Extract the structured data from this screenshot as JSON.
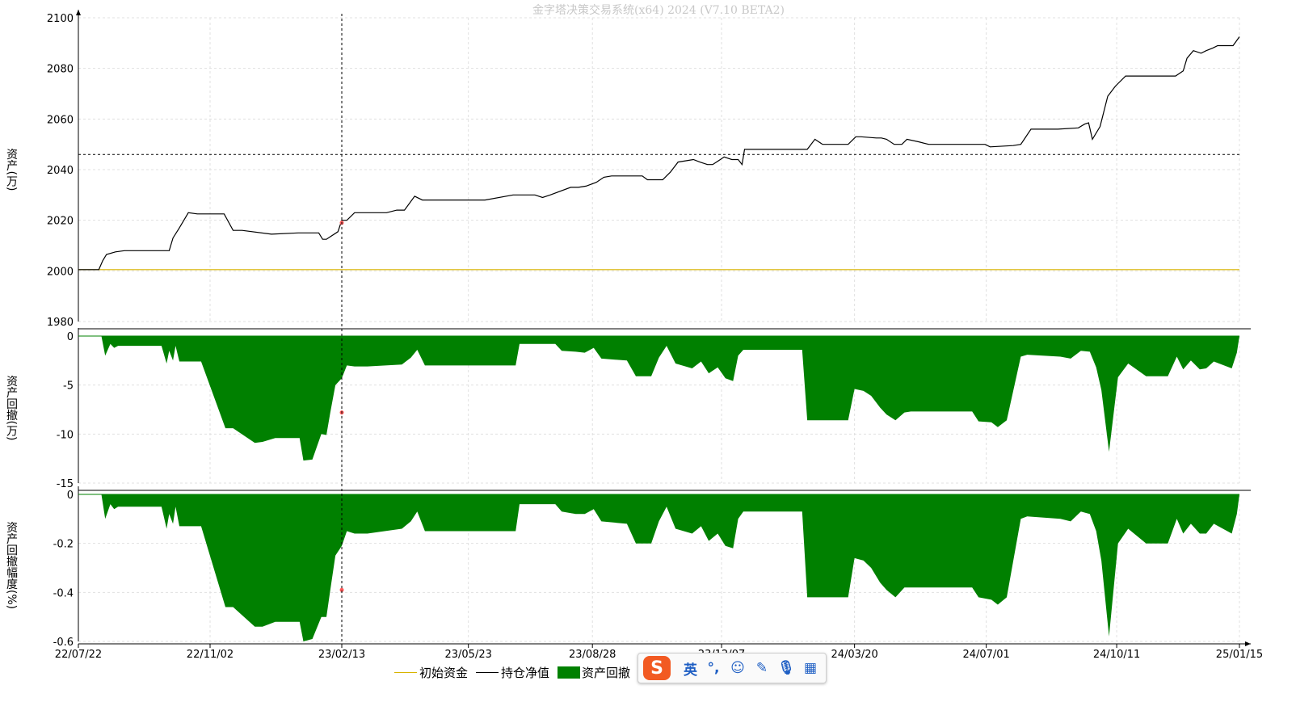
{
  "window": {
    "title": "金字塔决策交易系统(x64) 2024 (V7.10 BETA2)"
  },
  "legend": {
    "initial_capital": "初始资金",
    "position_value": "持仓净值",
    "asset_drawdown": "资产回撤"
  },
  "ime_toolbar": {
    "logo": "S",
    "mode": "英",
    "punct_icon": "punctuation-icon",
    "emoji_icon": "emoji-icon",
    "pen_icon": "pen-icon",
    "mic_icon": "microphone-icon",
    "grid_icon": "toolbox-icon"
  },
  "colors": {
    "initial_line": "#d8b400",
    "value_line": "#000000",
    "drawdown_fill": "#008000",
    "marker": "#ff5a5a",
    "grid": "#e0e0e0"
  },
  "chart_data": [
    {
      "type": "line",
      "ylabel": "资产(万)",
      "ylim": [
        1980,
        2100
      ],
      "yticks": [
        "2100",
        "2080",
        "2060",
        "2040",
        "2020",
        "2000",
        "1980"
      ],
      "x_range": [
        "2022-07-22",
        "2025-01-15"
      ],
      "reference_lines": {
        "horizontal_value": 2046,
        "vertical_date": "2023-02-13"
      },
      "cursor_marker": {
        "x": "2023-02-13",
        "y": 2019
      },
      "series": [
        {
          "name": "初始资金",
          "x": [
            "2022-07-22",
            "2025-01-15"
          ],
          "y": [
            2000.5,
            2000.5
          ]
        },
        {
          "name": "持仓净值",
          "x": [
            "2022-07-22",
            "2022-08-07",
            "2022-08-10",
            "2022-08-13",
            "2022-08-20",
            "2022-08-27",
            "2022-09-15",
            "2022-10-01",
            "2022-10-04",
            "2022-10-09",
            "2022-10-16",
            "2022-10-23",
            "2022-10-31",
            "2022-11-13",
            "2022-11-20",
            "2022-11-27",
            "2022-12-20",
            "2023-01-10",
            "2023-01-15",
            "2023-01-26",
            "2023-01-29",
            "2023-02-01",
            "2023-02-04",
            "2023-02-10",
            "2023-02-13",
            "2023-02-17",
            "2023-02-23",
            "2023-03-05",
            "2023-03-20",
            "2023-03-28",
            "2023-04-03",
            "2023-04-11",
            "2023-04-17",
            "2023-05-09",
            "2023-06-05",
            "2023-06-27",
            "2023-07-03",
            "2023-07-07",
            "2023-07-14",
            "2023-07-20",
            "2023-07-26",
            "2023-08-11",
            "2023-08-17",
            "2023-08-23",
            "2023-08-31",
            "2023-09-06",
            "2023-09-12",
            "2023-10-06",
            "2023-10-10",
            "2023-10-22",
            "2023-10-28",
            "2023-11-03",
            "2023-11-15",
            "2023-11-20",
            "2023-11-26",
            "2023-11-30",
            "2023-12-06",
            "2023-12-09",
            "2023-12-15",
            "2023-12-20",
            "2023-12-23",
            "2023-12-25",
            "2024-01-12",
            "2024-02-12",
            "2024-02-18",
            "2024-02-24",
            "2024-03-15",
            "2024-03-21",
            "2024-03-25",
            "2024-04-06",
            "2024-04-10",
            "2024-04-14",
            "2024-04-20",
            "2024-04-26",
            "2024-04-30",
            "2024-05-09",
            "2024-05-17",
            "2024-05-29",
            "2024-06-06",
            "2024-06-26",
            "2024-06-30",
            "2024-07-04",
            "2024-07-22",
            "2024-07-28",
            "2024-08-05",
            "2024-08-26",
            "2024-09-11",
            "2024-09-16",
            "2024-09-19",
            "2024-09-22",
            "2024-09-28",
            "2024-10-04",
            "2024-10-10",
            "2024-10-18",
            "2024-11-13",
            "2024-11-26",
            "2024-12-02",
            "2024-12-05",
            "2024-12-10",
            "2024-12-16",
            "2024-12-20",
            "2024-12-25",
            "2024-12-29",
            "2025-01-06",
            "2025-01-10",
            "2025-01-15"
          ],
          "y": [
            2000.5,
            2000.5,
            2004,
            2006.5,
            2007.5,
            2008,
            2008,
            2008,
            2013,
            2017,
            2023,
            2022.5,
            2022.5,
            2022.5,
            2016,
            2016,
            2014.5,
            2015,
            2015,
            2015,
            2012.5,
            2012.5,
            2013.5,
            2015.5,
            2020,
            2020,
            2023,
            2023,
            2023,
            2024,
            2024,
            2029.5,
            2028,
            2028,
            2028,
            2030,
            2030,
            2030,
            2030,
            2029,
            2030,
            2033,
            2033,
            2033.5,
            2035,
            2037,
            2037.5,
            2037.5,
            2036,
            2036,
            2039,
            2043,
            2044,
            2043,
            2042,
            2042,
            2044,
            2045,
            2044,
            2044,
            2042,
            2048,
            2048,
            2048,
            2052,
            2050,
            2050,
            2053,
            2053,
            2052.5,
            2052.5,
            2052,
            2050,
            2050,
            2052,
            2051,
            2050,
            2050,
            2050,
            2050,
            2050,
            2049,
            2049.5,
            2050,
            2056,
            2056,
            2056.5,
            2058,
            2058.5,
            2052,
            2057,
            2069,
            2073,
            2077,
            2077,
            2077,
            2079,
            2084,
            2087,
            2086,
            2087,
            2088,
            2089,
            2089,
            2089,
            2092.5
          ]
        }
      ]
    },
    {
      "type": "area",
      "ylabel": "资产回撤(万)",
      "ylim": [
        -15,
        0
      ],
      "yticks": [
        "0",
        "-5",
        "-10",
        "-15"
      ],
      "cursor_marker": {
        "x": "2023-02-13",
        "y": -7.8
      },
      "series": [
        {
          "name": "资产回撤",
          "x": [
            "2022-07-22",
            "2022-08-09",
            "2022-08-12",
            "2022-08-16",
            "2022-08-19",
            "2022-08-22",
            "2022-09-25",
            "2022-09-29",
            "2022-10-01",
            "2022-10-04",
            "2022-10-06",
            "2022-10-09",
            "2022-10-26",
            "2022-11-14",
            "2022-11-20",
            "2022-12-07",
            "2022-12-13",
            "2022-12-23",
            "2023-01-11",
            "2023-01-14",
            "2023-01-21",
            "2023-01-28",
            "2023-02-01",
            "2023-02-04",
            "2023-02-08",
            "2023-02-13",
            "2023-02-17",
            "2023-02-23",
            "2023-03-05",
            "2023-04-01",
            "2023-04-08",
            "2023-04-13",
            "2023-04-19",
            "2023-05-01",
            "2023-06-29",
            "2023-07-02",
            "2023-07-30",
            "2023-08-04",
            "2023-08-15",
            "2023-08-22",
            "2023-08-29",
            "2023-09-04",
            "2023-09-24",
            "2023-10-01",
            "2023-10-13",
            "2023-10-19",
            "2023-10-25",
            "2023-11-01",
            "2023-11-14",
            "2023-11-21",
            "2023-11-27",
            "2023-12-04",
            "2023-12-10",
            "2023-12-16",
            "2023-12-20",
            "2023-12-24",
            "2024-01-07",
            "2024-02-08",
            "2024-02-12",
            "2024-02-18",
            "2024-03-15",
            "2024-03-20",
            "2024-03-27",
            "2024-04-02",
            "2024-04-09",
            "2024-04-14",
            "2024-04-21",
            "2024-04-28",
            "2024-05-03",
            "2024-05-18",
            "2024-06-20",
            "2024-06-25",
            "2024-07-05",
            "2024-07-10",
            "2024-07-17",
            "2024-07-28",
            "2024-08-02",
            "2024-08-28",
            "2024-09-05",
            "2024-09-13",
            "2024-09-20",
            "2024-09-25",
            "2024-09-29",
            "2024-10-05",
            "2024-10-12",
            "2024-10-20",
            "2024-11-03",
            "2024-11-13",
            "2024-11-20",
            "2024-11-27",
            "2024-12-02",
            "2024-12-08",
            "2024-12-15",
            "2024-12-20",
            "2024-12-26",
            "2025-01-09",
            "2025-01-13",
            "2025-01-15"
          ],
          "y": [
            0,
            0,
            -2,
            -0.8,
            -1.2,
            -1,
            -1,
            -2.8,
            -1.5,
            -2.5,
            -1,
            -2.6,
            -2.6,
            -9.4,
            -9.4,
            -10.9,
            -10.8,
            -10.4,
            -10.4,
            -12.7,
            -12.6,
            -10,
            -10.1,
            -7.8,
            -5,
            -4.3,
            -3,
            -3.1,
            -3.1,
            -2.9,
            -2.2,
            -1.4,
            -3,
            -3,
            -3,
            -0.8,
            -0.8,
            -1.5,
            -1.6,
            -1.7,
            -1.2,
            -2.3,
            -2.5,
            -4.1,
            -4.1,
            -2.2,
            -1,
            -2.8,
            -3.3,
            -2.6,
            -3.8,
            -3.2,
            -4.3,
            -4.6,
            -2,
            -1.4,
            -1.4,
            -1.4,
            -8.6,
            -8.6,
            -8.6,
            -5.4,
            -5.6,
            -6.1,
            -7.3,
            -8,
            -8.6,
            -7.8,
            -7.7,
            -7.7,
            -7.7,
            -8.7,
            -8.8,
            -9.3,
            -8.6,
            -2.1,
            -1.9,
            -2.1,
            -2.3,
            -1.5,
            -1.6,
            -3.2,
            -5.5,
            -11.8,
            -4.2,
            -2.8,
            -4.1,
            -4.1,
            -4.1,
            -2.1,
            -3.4,
            -2.5,
            -3.4,
            -3.3,
            -2.6,
            -3.3,
            -1.7,
            0
          ]
        }
      ]
    },
    {
      "type": "area",
      "ylabel": "资产回撤幅度(%)",
      "ylim": [
        -0.6,
        0
      ],
      "yticks": [
        "0",
        "-0.2",
        "-0.4",
        "-0.6"
      ],
      "cursor_marker": {
        "x": "2023-02-13",
        "y": -0.39
      },
      "series": [
        {
          "name": "资产回撤幅度",
          "x": [
            "2022-07-22",
            "2022-08-09",
            "2022-08-12",
            "2022-08-16",
            "2022-08-19",
            "2022-08-22",
            "2022-09-25",
            "2022-09-29",
            "2022-10-01",
            "2022-10-04",
            "2022-10-06",
            "2022-10-09",
            "2022-10-26",
            "2022-11-14",
            "2022-11-20",
            "2022-12-07",
            "2022-12-13",
            "2022-12-23",
            "2023-01-11",
            "2023-01-14",
            "2023-01-21",
            "2023-01-28",
            "2023-02-01",
            "2023-02-04",
            "2023-02-08",
            "2023-02-13",
            "2023-02-17",
            "2023-02-23",
            "2023-03-05",
            "2023-04-01",
            "2023-04-08",
            "2023-04-13",
            "2023-04-19",
            "2023-05-01",
            "2023-06-29",
            "2023-07-02",
            "2023-07-30",
            "2023-08-04",
            "2023-08-15",
            "2023-08-22",
            "2023-08-29",
            "2023-09-04",
            "2023-09-24",
            "2023-10-01",
            "2023-10-13",
            "2023-10-19",
            "2023-10-25",
            "2023-11-01",
            "2023-11-14",
            "2023-11-21",
            "2023-11-27",
            "2023-12-04",
            "2023-12-10",
            "2023-12-16",
            "2023-12-20",
            "2023-12-24",
            "2024-01-07",
            "2024-02-08",
            "2024-02-12",
            "2024-02-18",
            "2024-03-15",
            "2024-03-20",
            "2024-03-27",
            "2024-04-02",
            "2024-04-09",
            "2024-04-14",
            "2024-04-21",
            "2024-04-28",
            "2024-05-03",
            "2024-05-18",
            "2024-06-20",
            "2024-06-25",
            "2024-07-05",
            "2024-07-10",
            "2024-07-17",
            "2024-07-28",
            "2024-08-02",
            "2024-08-28",
            "2024-09-05",
            "2024-09-13",
            "2024-09-20",
            "2024-09-25",
            "2024-09-29",
            "2024-10-05",
            "2024-10-12",
            "2024-10-20",
            "2024-11-03",
            "2024-11-13",
            "2024-11-20",
            "2024-11-27",
            "2024-12-02",
            "2024-12-08",
            "2024-12-15",
            "2024-12-20",
            "2024-12-26",
            "2025-01-09",
            "2025-01-13",
            "2025-01-15"
          ],
          "y": [
            0,
            0,
            -0.1,
            -0.04,
            -0.06,
            -0.05,
            -0.05,
            -0.14,
            -0.08,
            -0.12,
            -0.05,
            -0.13,
            -0.13,
            -0.46,
            -0.46,
            -0.54,
            -0.54,
            -0.52,
            -0.52,
            -0.6,
            -0.59,
            -0.5,
            -0.5,
            -0.39,
            -0.25,
            -0.21,
            -0.15,
            -0.16,
            -0.16,
            -0.14,
            -0.11,
            -0.07,
            -0.15,
            -0.15,
            -0.15,
            -0.04,
            -0.04,
            -0.07,
            -0.08,
            -0.08,
            -0.06,
            -0.11,
            -0.12,
            -0.2,
            -0.2,
            -0.11,
            -0.05,
            -0.14,
            -0.16,
            -0.13,
            -0.19,
            -0.16,
            -0.21,
            -0.22,
            -0.1,
            -0.07,
            -0.07,
            -0.07,
            -0.42,
            -0.42,
            -0.42,
            -0.26,
            -0.27,
            -0.3,
            -0.36,
            -0.39,
            -0.42,
            -0.38,
            -0.38,
            -0.38,
            -0.38,
            -0.42,
            -0.43,
            -0.45,
            -0.42,
            -0.1,
            -0.09,
            -0.1,
            -0.11,
            -0.07,
            -0.08,
            -0.15,
            -0.27,
            -0.58,
            -0.2,
            -0.14,
            -0.2,
            -0.2,
            -0.2,
            -0.1,
            -0.16,
            -0.12,
            -0.16,
            -0.16,
            -0.12,
            -0.16,
            -0.08,
            0
          ]
        }
      ]
    }
  ],
  "x_axis": {
    "ticks": [
      {
        "label": "22/07/22",
        "date": "2022-07-22"
      },
      {
        "label": "22/11/02",
        "date": "2022-11-02"
      },
      {
        "label": "23/02/13",
        "date": "2023-02-13"
      },
      {
        "label": "23/05/23",
        "date": "2023-05-23"
      },
      {
        "label": "23/08/28",
        "date": "2023-08-28"
      },
      {
        "label": "23/12/07",
        "date": "2023-12-07"
      },
      {
        "label": "24/03/20",
        "date": "2024-03-20"
      },
      {
        "label": "24/07/01",
        "date": "2024-07-01"
      },
      {
        "label": "24/10/11",
        "date": "2024-10-11"
      },
      {
        "label": "25/01/15",
        "date": "2025-01-15"
      }
    ]
  }
}
